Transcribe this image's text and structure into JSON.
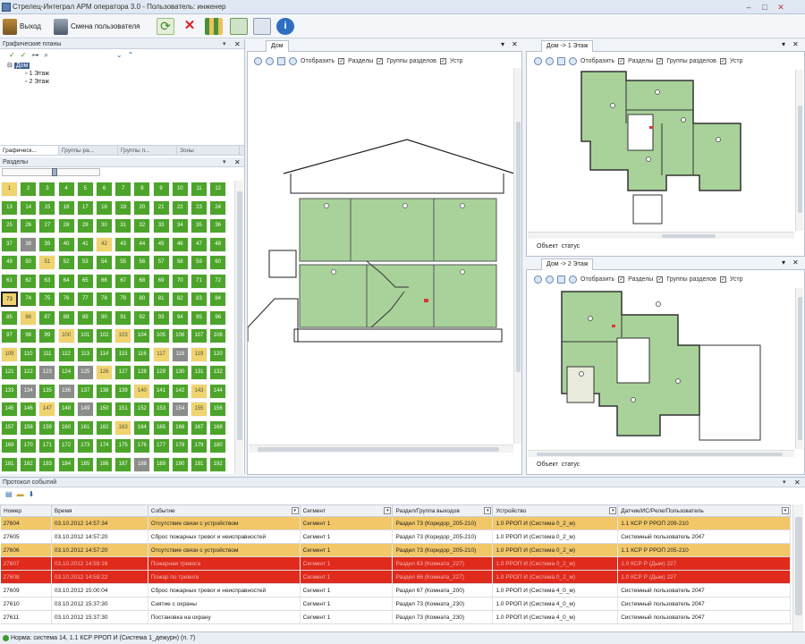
{
  "app": {
    "title": "Стрелец-Интеграл АРМ оператора 3.0 - Пользователь: инженер"
  },
  "toolbar": {
    "exit_label": "Выход",
    "switch_user_label": "Смена пользователя"
  },
  "left_panel": {
    "title": "Графические планы",
    "tree": {
      "root": "Дом",
      "floors": [
        "1 Этаж",
        "2 Этаж"
      ]
    },
    "tabs": [
      "Графическ...",
      "Группы ра...",
      "Группы п...",
      "Зоны"
    ]
  },
  "sections_panel": {
    "title": "Разделы",
    "rows": [
      [
        [
          "1",
          "y"
        ],
        [
          "2",
          "g"
        ],
        [
          "3",
          "g"
        ],
        [
          "4",
          "g"
        ],
        [
          "5",
          "g"
        ],
        [
          "6",
          "g"
        ],
        [
          "7",
          "g"
        ],
        [
          "8",
          "g"
        ],
        [
          "9",
          "g"
        ],
        [
          "10",
          "g"
        ],
        [
          "11",
          "g"
        ],
        [
          "12",
          "g"
        ]
      ],
      [
        [
          "13",
          "g"
        ],
        [
          "14",
          "g"
        ],
        [
          "15",
          "g"
        ],
        [
          "16",
          "g"
        ],
        [
          "17",
          "g"
        ],
        [
          "18",
          "g"
        ],
        [
          "19",
          "g"
        ],
        [
          "20",
          "g"
        ],
        [
          "21",
          "g"
        ],
        [
          "22",
          "g"
        ],
        [
          "23",
          "g"
        ],
        [
          "24",
          "g"
        ]
      ],
      [
        [
          "25",
          "g"
        ],
        [
          "26",
          "g"
        ],
        [
          "27",
          "g"
        ],
        [
          "28",
          "g"
        ],
        [
          "29",
          "g"
        ],
        [
          "30",
          "g"
        ],
        [
          "31",
          "g"
        ],
        [
          "32",
          "g"
        ],
        [
          "33",
          "g"
        ],
        [
          "34",
          "g"
        ],
        [
          "35",
          "g"
        ],
        [
          "36",
          "g"
        ]
      ],
      [
        [
          "37",
          "g"
        ],
        [
          "38",
          "gr"
        ],
        [
          "39",
          "g"
        ],
        [
          "40",
          "g"
        ],
        [
          "41",
          "g"
        ],
        [
          "42",
          "y"
        ],
        [
          "43",
          "g"
        ],
        [
          "44",
          "g"
        ],
        [
          "45",
          "g"
        ],
        [
          "46",
          "g"
        ],
        [
          "47",
          "g"
        ],
        [
          "48",
          "g"
        ]
      ],
      [
        [
          "49",
          "g"
        ],
        [
          "50",
          "g"
        ],
        [
          "51",
          "y"
        ],
        [
          "52",
          "g"
        ],
        [
          "53",
          "g"
        ],
        [
          "54",
          "g"
        ],
        [
          "55",
          "g"
        ],
        [
          "56",
          "g"
        ],
        [
          "57",
          "g"
        ],
        [
          "58",
          "g"
        ],
        [
          "59",
          "g"
        ],
        [
          "60",
          "g"
        ]
      ],
      [
        [
          "61",
          "g"
        ],
        [
          "62",
          "g"
        ],
        [
          "63",
          "g"
        ],
        [
          "64",
          "g"
        ],
        [
          "65",
          "g"
        ],
        [
          "66",
          "g"
        ],
        [
          "67",
          "g"
        ],
        [
          "68",
          "g"
        ],
        [
          "69",
          "g"
        ],
        [
          "70",
          "g"
        ],
        [
          "71",
          "g"
        ],
        [
          "72",
          "g"
        ]
      ],
      [
        [
          "73",
          "y"
        ],
        [
          "74",
          "g"
        ],
        [
          "75",
          "g"
        ],
        [
          "76",
          "g"
        ],
        [
          "77",
          "g"
        ],
        [
          "78",
          "g"
        ],
        [
          "79",
          "g"
        ],
        [
          "80",
          "g"
        ],
        [
          "81",
          "g"
        ],
        [
          "82",
          "g"
        ],
        [
          "83",
          "g"
        ],
        [
          "84",
          "g"
        ]
      ],
      [
        [
          "85",
          "g"
        ],
        [
          "86",
          "y"
        ],
        [
          "87",
          "g"
        ],
        [
          "88",
          "g"
        ],
        [
          "89",
          "g"
        ],
        [
          "90",
          "g"
        ],
        [
          "91",
          "g"
        ],
        [
          "92",
          "g"
        ],
        [
          "93",
          "g"
        ],
        [
          "94",
          "g"
        ],
        [
          "95",
          "g"
        ],
        [
          "96",
          "g"
        ]
      ],
      [
        [
          "97",
          "g"
        ],
        [
          "98",
          "g"
        ],
        [
          "99",
          "g"
        ],
        [
          "100",
          "y"
        ],
        [
          "101",
          "g"
        ],
        [
          "102",
          "g"
        ],
        [
          "103",
          "y"
        ],
        [
          "104",
          "g"
        ],
        [
          "105",
          "g"
        ],
        [
          "106",
          "g"
        ],
        [
          "107",
          "g"
        ],
        [
          "108",
          "g"
        ]
      ],
      [
        [
          "109",
          "y"
        ],
        [
          "110",
          "g"
        ],
        [
          "111",
          "g"
        ],
        [
          "112",
          "g"
        ],
        [
          "113",
          "g"
        ],
        [
          "114",
          "g"
        ],
        [
          "115",
          "g"
        ],
        [
          "116",
          "g"
        ],
        [
          "117",
          "y"
        ],
        [
          "118",
          "gr"
        ],
        [
          "119",
          "y"
        ],
        [
          "120",
          "g"
        ]
      ],
      [
        [
          "121",
          "g"
        ],
        [
          "122",
          "g"
        ],
        [
          "123",
          "gr"
        ],
        [
          "124",
          "g"
        ],
        [
          "125",
          "gr"
        ],
        [
          "126",
          "y"
        ],
        [
          "127",
          "g"
        ],
        [
          "128",
          "g"
        ],
        [
          "129",
          "g"
        ],
        [
          "130",
          "g"
        ],
        [
          "131",
          "g"
        ],
        [
          "132",
          "g"
        ]
      ],
      [
        [
          "133",
          "g"
        ],
        [
          "134",
          "gr"
        ],
        [
          "135",
          "g"
        ],
        [
          "136",
          "gr"
        ],
        [
          "137",
          "g"
        ],
        [
          "138",
          "g"
        ],
        [
          "139",
          "g"
        ],
        [
          "140",
          "y"
        ],
        [
          "141",
          "g"
        ],
        [
          "142",
          "g"
        ],
        [
          "143",
          "y"
        ],
        [
          "144",
          "g"
        ]
      ],
      [
        [
          "145",
          "g"
        ],
        [
          "146",
          "g"
        ],
        [
          "147",
          "y"
        ],
        [
          "148",
          "g"
        ],
        [
          "149",
          "gr"
        ],
        [
          "150",
          "g"
        ],
        [
          "151",
          "g"
        ],
        [
          "152",
          "g"
        ],
        [
          "153",
          "g"
        ],
        [
          "154",
          "gr"
        ],
        [
          "155",
          "y"
        ],
        [
          "156",
          "g"
        ]
      ],
      [
        [
          "157",
          "g"
        ],
        [
          "158",
          "g"
        ],
        [
          "159",
          "g"
        ],
        [
          "160",
          "g"
        ],
        [
          "161",
          "g"
        ],
        [
          "162",
          "g"
        ],
        [
          "163",
          "y"
        ],
        [
          "164",
          "g"
        ],
        [
          "165",
          "g"
        ],
        [
          "166",
          "g"
        ],
        [
          "167",
          "g"
        ],
        [
          "168",
          "g"
        ]
      ],
      [
        [
          "169",
          "g"
        ],
        [
          "170",
          "g"
        ],
        [
          "171",
          "g"
        ],
        [
          "172",
          "g"
        ],
        [
          "173",
          "g"
        ],
        [
          "174",
          "g"
        ],
        [
          "175",
          "g"
        ],
        [
          "176",
          "g"
        ],
        [
          "177",
          "g"
        ],
        [
          "178",
          "g"
        ],
        [
          "179",
          "g"
        ],
        [
          "180",
          "g"
        ]
      ],
      [
        [
          "181",
          "g"
        ],
        [
          "182",
          "g"
        ],
        [
          "183",
          "g"
        ],
        [
          "184",
          "g"
        ],
        [
          "185",
          "g"
        ],
        [
          "186",
          "g"
        ],
        [
          "187",
          "g"
        ],
        [
          "188",
          "gr"
        ],
        [
          "189",
          "g"
        ],
        [
          "190",
          "g"
        ],
        [
          "191",
          "g"
        ],
        [
          "192",
          "g"
        ]
      ]
    ]
  },
  "views": {
    "house": {
      "tab": "Дом"
    },
    "floor1": {
      "tab": "Дом -> 1 Этаж",
      "footer_objects": "Объект",
      "footer_status": "статус"
    },
    "floor2": {
      "tab": "Дом -> 2 Этаж",
      "footer_objects": "Объект",
      "footer_status": "статус"
    },
    "toolbar": {
      "show": "Отобразить",
      "sections": "Разделы",
      "groups": "Группы разделов",
      "devices": "Устр"
    }
  },
  "events": {
    "title": "Протокол событий",
    "columns": [
      "Номер",
      "Время",
      "Событие",
      "Сегмент",
      "Раздел/Группа выходов",
      "Устройство",
      "Датчик/ИС/Реле/Пользователь"
    ],
    "rows": [
      {
        "style": "yel",
        "cells": [
          "27604",
          "03.10.2012 14:57:34",
          "Отсутствие связи с устройством",
          "Сегмент 1",
          "Раздел 73 (Коридор_205-210)",
          "1.0 РРОП И (Система 0_2_м)",
          "1.1 КСР Р РРОП 209-210"
        ]
      },
      {
        "style": "",
        "cells": [
          "27605",
          "03.10.2012 14:57:20",
          "Сброс пожарных тревог и неисправностей",
          "Сегмент 1",
          "Раздел 73 (Коридор_205-210)",
          "1.0 РРОП И (Система 0_2_м)",
          "Системный пользователь 2047"
        ]
      },
      {
        "style": "yel",
        "cells": [
          "27606",
          "03.10.2012 14:57:20",
          "Отсутствие связи с устройством",
          "Сегмент 1",
          "Раздел 73 (Коридор_205-210)",
          "1.0 РРОП И (Система 0_2_м)",
          "1.1 КСР Р РРОП 205-210"
        ]
      },
      {
        "style": "red",
        "cells": [
          "27607",
          "03.10.2012 14:59:16",
          "Пожарная тревога",
          "Сегмент 1",
          "Раздел 63 (Комната_227)",
          "1.0 РРОП И (Система 0_2_м)",
          "1.0 КСР Р (Дым) 227"
        ]
      },
      {
        "style": "red",
        "cells": [
          "27608",
          "03.10.2012 14:59:22",
          "Пожар по тревоге",
          "Сегмент 1",
          "Раздел 66 (Комната_227)",
          "1.0 РРОП И (Система 0_2_м)",
          "1.0 КСР Р (Дым) 227"
        ]
      },
      {
        "style": "",
        "cells": [
          "27609",
          "03.10.2012 15:00:04",
          "Сброс пожарных тревог и неисправностей",
          "Сегмент 1",
          "Раздел 67 (Комната_200)",
          "1.0 РРОП И (Система 4_0_м)",
          "Системный пользователь 2047"
        ]
      },
      {
        "style": "",
        "cells": [
          "27610",
          "03.10.2012 15:37:30",
          "Снятие с охраны",
          "Сегмент 1",
          "Раздел 73 (Комната_230)",
          "1.0 РРОП И (Система 4_0_м)",
          "Системный пользователь 2047"
        ]
      },
      {
        "style": "",
        "cells": [
          "27611",
          "03.10.2012 15:37:30",
          "Постановка на охрану",
          "Сегмент 1",
          "Раздел 73 (Комната_230)",
          "1.0 РРОП И (Система 4_0_м)",
          "Системный пользователь 2047"
        ]
      }
    ]
  },
  "status": {
    "text": "Норма: система 14, 1.1 КСР РРОП И (Система 1_дежурн) (п. 7)"
  }
}
